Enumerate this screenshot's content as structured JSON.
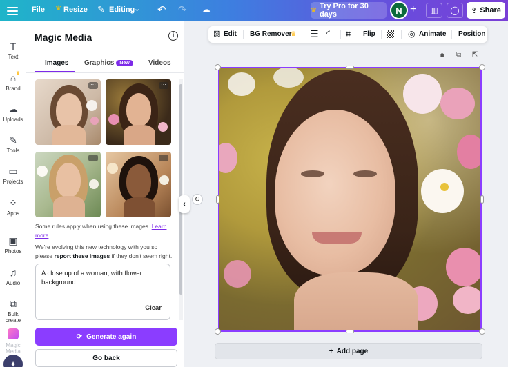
{
  "topbar": {
    "file": "File",
    "resize": "Resize",
    "editing": "Editing",
    "try_pro": "Try Pro for 30 days",
    "avatar_initial": "N",
    "share": "Share"
  },
  "rail": {
    "items": [
      {
        "label": "Text",
        "icon": "T"
      },
      {
        "label": "Brand",
        "icon": "⌂"
      },
      {
        "label": "Uploads",
        "icon": "☁"
      },
      {
        "label": "Tools",
        "icon": "✎"
      },
      {
        "label": "Projects",
        "icon": "▭"
      },
      {
        "label": "Apps",
        "icon": "⁘"
      },
      {
        "label": "Photos",
        "icon": "▣"
      },
      {
        "label": "Audio",
        "icon": "♫"
      },
      {
        "label": "Bulk create",
        "icon": "⧉"
      },
      {
        "label": "Magic Media",
        "icon": ""
      }
    ]
  },
  "panel": {
    "title": "Magic Media",
    "tabs": [
      {
        "label": "Images"
      },
      {
        "label": "Graphics",
        "badge": "New"
      },
      {
        "label": "Videos"
      }
    ],
    "rules_text": "Some rules apply when using these images.",
    "learn_more": "Learn more",
    "evolving_pre": "We're evolving this new technology with you so please",
    "report_link": "report these images",
    "evolving_post": "if they don't seem right.",
    "prompt": "A close up of a woman, with flower background",
    "clear": "Clear",
    "generate_again": "Generate again",
    "go_back": "Go back"
  },
  "context_toolbar": {
    "edit": "Edit",
    "bg_remover": "BG Remover",
    "flip": "Flip",
    "animate": "Animate",
    "position": "Position"
  },
  "canvas": {
    "add_page": "Add page"
  },
  "colors": {
    "accent": "#8b3dff",
    "avatar": "#0c6b3c",
    "crown": "#ffc400"
  }
}
